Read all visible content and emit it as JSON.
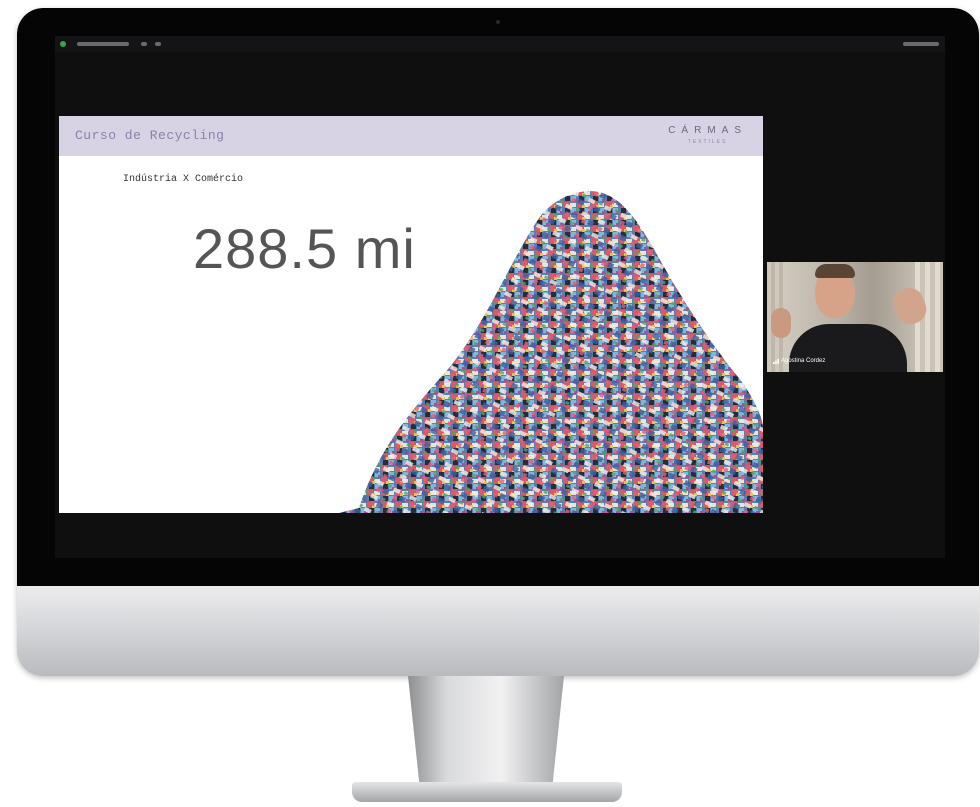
{
  "slide": {
    "title": "Curso de Recycling",
    "brand_name": "CÁRMAS",
    "brand_sub": "TEXTILES",
    "subtitle": "Indústria X Comércio",
    "big_number": "288.5 mi"
  },
  "participant": {
    "name": "Agostina Cordez"
  },
  "colors": {
    "slide_header": "#d8d2e5",
    "bezel": "#050505",
    "screen_bg": "#0f0f10"
  }
}
